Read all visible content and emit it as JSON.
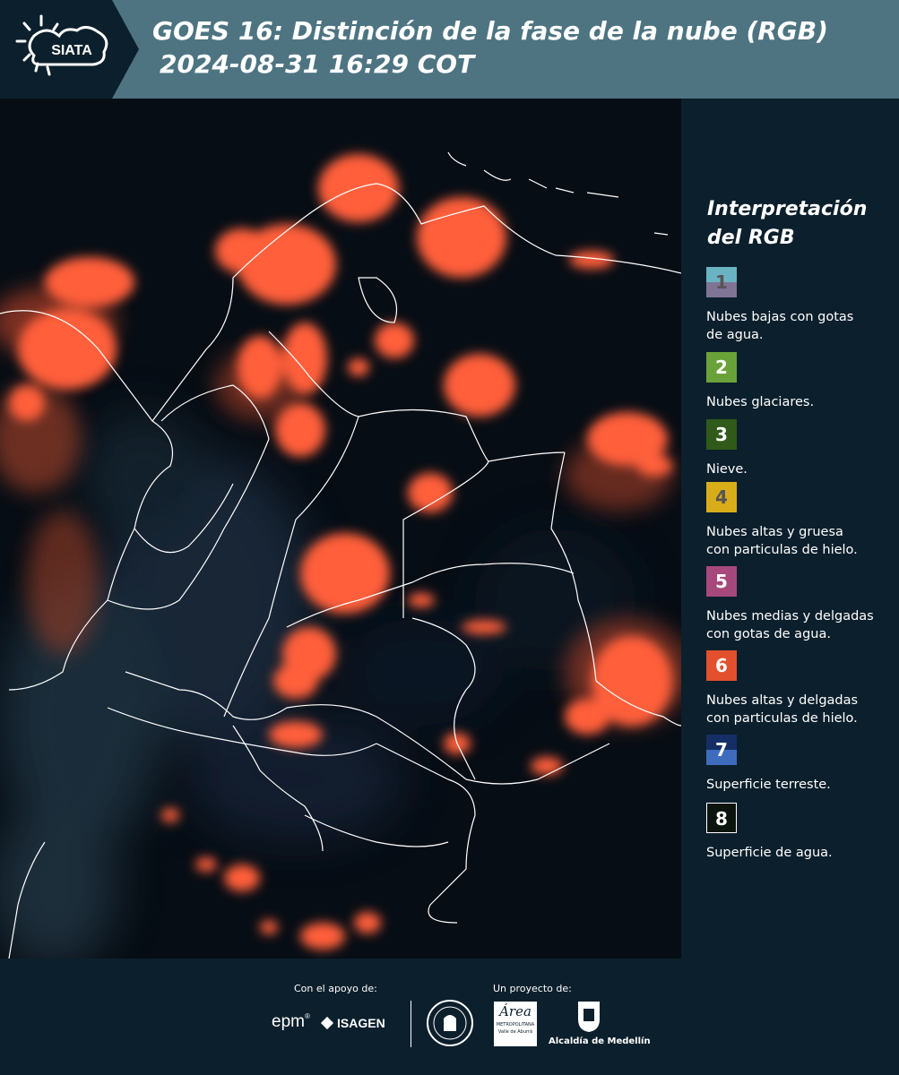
{
  "header": {
    "logo_text": "SIATA",
    "title_line1": "GOES 16: Distinción de la fase de la nube (RGB)",
    "title_line2": "2024-08-31 16:29 COT"
  },
  "legend": {
    "title_line1": "Interpretación",
    "title_line2": "del RGB",
    "items": [
      {
        "num": "1",
        "label_line1": "Nubes bajas con gotas",
        "label_line2": "de agua.",
        "color_top": "#6ab3c3",
        "color_bottom": "#7f7494",
        "text_color": "#555555"
      },
      {
        "num": "2",
        "label_line1": "Nubes glaciares.",
        "label_line2": "",
        "color_top": "#6aa23a",
        "color_bottom": "#6aa23a",
        "text_color": "#ffffff"
      },
      {
        "num": "3",
        "label_line1": "Nieve.",
        "label_line2": "",
        "color_top": "#2f5a19",
        "color_bottom": "#2f5a19",
        "text_color": "#ffffff"
      },
      {
        "num": "4",
        "label_line1": "Nubes altas y gruesa",
        "label_line2": "con particulas de hielo.",
        "color_top": "#d9ac1a",
        "color_bottom": "#d9ac1a",
        "text_color": "#555555"
      },
      {
        "num": "5",
        "label_line1": "Nubes medias y delgadas",
        "label_line2": "con gotas de agua.",
        "color_top": "#a6487c",
        "color_bottom": "#a6487c",
        "text_color": "#ffffff"
      },
      {
        "num": "6",
        "label_line1": "Nubes altas y delgadas",
        "label_line2": "con particulas de hielo.",
        "color_top": "#e2502d",
        "color_bottom": "#e2502d",
        "text_color": "#ffffff"
      },
      {
        "num": "7",
        "label_line1": "Superficie terreste.",
        "label_line2": "",
        "color_top": "#152e66",
        "color_bottom": "#3f6bbd",
        "text_color": "#ffffff"
      },
      {
        "num": "8",
        "label_line1": "Superficie de agua.",
        "label_line2": "",
        "color_top": "#0c140e",
        "color_bottom": "#0c140e",
        "text_color": "#ffffff"
      }
    ]
  },
  "footer": {
    "support_label": "Con el apoyo de:",
    "project_label": "Un proyecto de:",
    "sponsor_epm": "epm",
    "sponsor_isagen": "ISAGEN",
    "area_logo_text": "Área",
    "area_sub1": "METROPOLITANA",
    "area_sub2": "Valle de Aburrá",
    "alcaldia": "Alcaldía de Medellín"
  }
}
